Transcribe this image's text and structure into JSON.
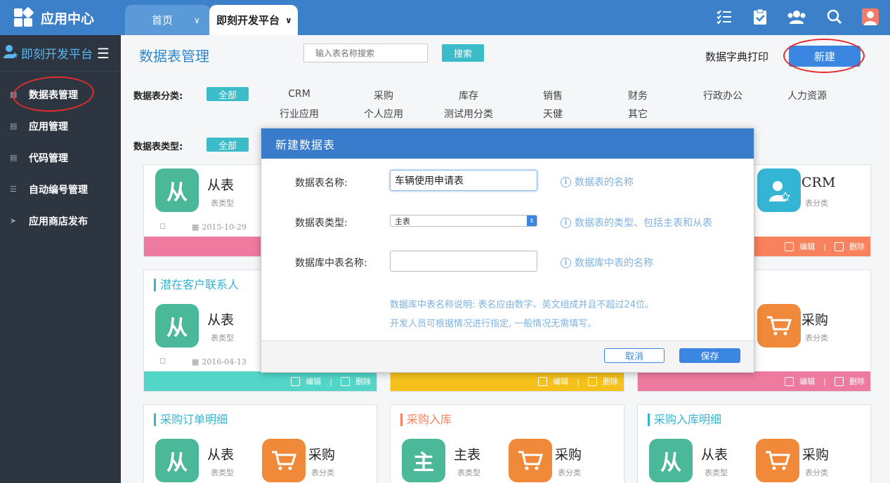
{
  "topbar": {
    "app_title": "应用中心",
    "tabs": [
      {
        "label": "首页"
      },
      {
        "label": "即刻开发平台"
      }
    ],
    "icons": [
      "tasks-icon",
      "clipboard-icon",
      "users-icon",
      "search-icon",
      "user-avatar-icon"
    ]
  },
  "sidebar": {
    "header": "即刻开发平台",
    "items": [
      {
        "label": "数据表管理",
        "icon": "table-icon"
      },
      {
        "label": "应用管理",
        "icon": "app-icon"
      },
      {
        "label": "代码管理",
        "icon": "code-icon"
      },
      {
        "label": "自动编号管理",
        "icon": "list-icon"
      },
      {
        "label": "应用商店发布",
        "icon": "rocket-icon"
      }
    ]
  },
  "main": {
    "title": "数据表管理",
    "search_placeholder": "输入表名称搜索",
    "search_btn": "搜索",
    "dict_print": "数据字典打印",
    "new_btn": "新建",
    "filter": {
      "category_label": "数据表分类:",
      "type_label": "数据表类型:",
      "all": "全部",
      "categories": [
        "CRM",
        "采购",
        "库存",
        "销售",
        "财务",
        "行政办公",
        "人力资源",
        "行业应用",
        "个人应用",
        "测试用分类",
        "天健",
        "其它"
      ]
    },
    "cards": [
      {
        "title": "",
        "type": "从表",
        "type_sub": "表类型",
        "user": "",
        "date": "2015-10-29",
        "edit": "编辑",
        "del": "删除"
      },
      {
        "title": "",
        "cat": "CRM",
        "cat_sub": "表分类",
        "edit": "编辑",
        "del": "删除"
      },
      {
        "title": "潜在客户联系人",
        "type": "从表",
        "type_sub": "表类型",
        "date": "2016-04-13",
        "edit": "编辑",
        "del": "删除"
      },
      {
        "title": "",
        "edit": "编辑",
        "del": "删除"
      },
      {
        "title": "",
        "cat": "采购",
        "cat_sub": "表分类",
        "edit": "编辑",
        "del": "删除"
      },
      {
        "title": "采购订单明细",
        "type": "从表",
        "type_sub": "表类型",
        "cat": "采购",
        "cat_sub": "表分类"
      },
      {
        "title": "采购入库",
        "type": "主表",
        "type_sub": "表类型",
        "cat": "采购",
        "cat_sub": "表分类"
      },
      {
        "title": "采购入库明细",
        "type": "从表",
        "type_sub": "表类型",
        "cat": "采购",
        "cat_sub": "表分类"
      }
    ]
  },
  "tile_glyphs": {
    "child": "从",
    "main": "主"
  },
  "modal": {
    "title": "新建数据表",
    "name_label": "数据表名称:",
    "name_value": "车辆使用申请表",
    "name_hint": "数据表的名称",
    "type_label": "数据表类型:",
    "type_value": "主表",
    "type_hint": "数据表的类型、包括主表和从表",
    "db_label": "数据库中表名称:",
    "db_value": "",
    "db_hint": "数据库中表的名称",
    "note1": "数据库中表名称说明: 表名应由数字、英文组成并且不超过24位。",
    "note2": "开发人员可根据情况进行指定, 一般情况无需填写。",
    "cancel": "取消",
    "save": "保存"
  },
  "colors": {
    "primary": "#3b80c8",
    "sidebar": "#2d3540",
    "teal": "#3bbcc8",
    "green": "#4cb89a",
    "orange": "#f08a3a",
    "pink": "#ee7aa0",
    "yellow": "#f5c11a",
    "coral": "#f7825d",
    "cyan": "#53d6c8"
  }
}
